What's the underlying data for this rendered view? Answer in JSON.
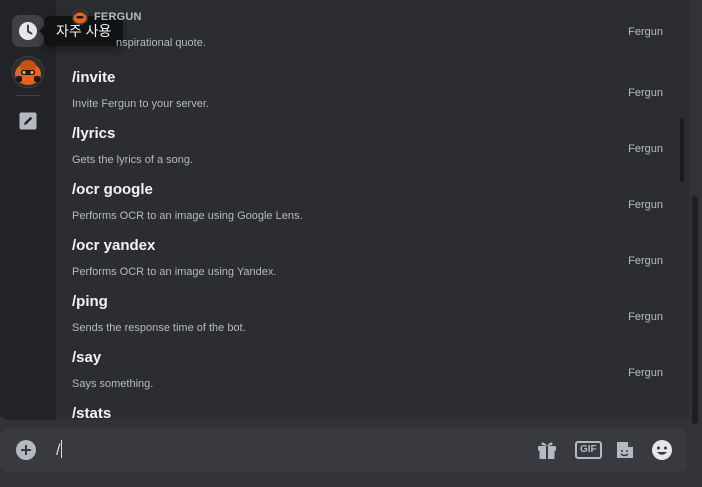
{
  "sidebar": {
    "recent_tooltip": "자주 사용"
  },
  "section": {
    "title": "FERGUN",
    "first_desc_partial": "nspirational quote.",
    "first_source": "Fergun"
  },
  "commands": [
    {
      "name": "/invite",
      "description": "Invite Fergun to your server.",
      "source": "Fergun"
    },
    {
      "name": "/lyrics",
      "description": "Gets the lyrics of a song.",
      "source": "Fergun"
    },
    {
      "name": "/ocr google",
      "description": "Performs OCR to an image using Google Lens.",
      "source": "Fergun"
    },
    {
      "name": "/ocr yandex",
      "description": "Performs OCR to an image using Yandex.",
      "source": "Fergun"
    },
    {
      "name": "/ping",
      "description": "Sends the response time of the bot.",
      "source": "Fergun"
    },
    {
      "name": "/say",
      "description": "Says something.",
      "source": "Fergun"
    },
    {
      "name": "/stats",
      "description": "",
      "source": ""
    }
  ],
  "chat": {
    "input_value": "/",
    "gif_label": "GIF"
  },
  "colors": {
    "background": "#313338",
    "popup": "#2b2d31",
    "sidebar": "#232428",
    "bot_accent": "#e8621a"
  }
}
